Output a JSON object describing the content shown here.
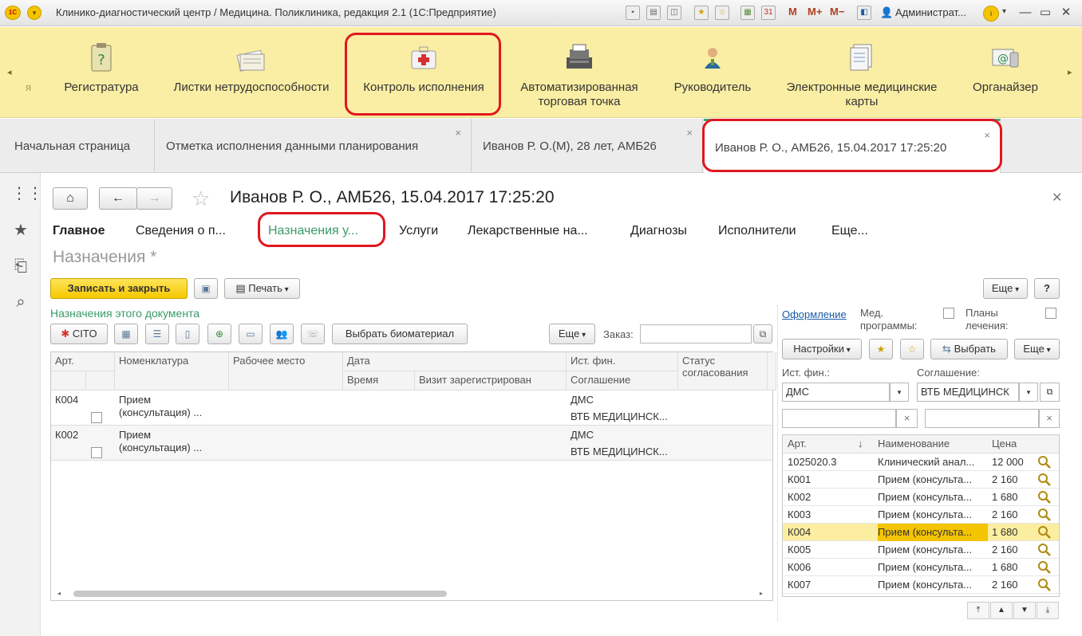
{
  "app": {
    "title": "Клинико-диагностический центр / Медицина. Поликлиника, редакция 2.1  (1С:Предприятие)",
    "logo_text": "1С",
    "user": "Администрат...",
    "memory_buttons": [
      "M",
      "M+",
      "M−"
    ]
  },
  "sections": {
    "left_partial": "я",
    "items": [
      {
        "label": "Регистратура",
        "icon": "clipboard-question-icon"
      },
      {
        "label": "Листки нетрудоспособности",
        "icon": "papers-icon"
      },
      {
        "label": "Контроль исполнения",
        "icon": "first-aid-kit-icon"
      },
      {
        "label": "Автоматизированная торговая точка",
        "icon": "cash-register-icon"
      },
      {
        "label": "Руководитель",
        "icon": "manager-icon"
      },
      {
        "label": "Электронные медицинские карты",
        "icon": "documents-icon"
      },
      {
        "label": "Органайзер",
        "icon": "email-icon"
      }
    ]
  },
  "tabs": [
    {
      "label": "Начальная страница",
      "closable": false
    },
    {
      "label": "Отметка исполнения данными планирования",
      "closable": true
    },
    {
      "label": "Иванов Р. О.(М), 28 лет, АМБ26",
      "closable": true
    },
    {
      "label": "Иванов Р. О., АМБ26, 15.04.2017 17:25:20",
      "closable": true,
      "active": true
    }
  ],
  "form": {
    "title": "Иванов Р. О., АМБ26, 15.04.2017 17:25:20",
    "nav": [
      "Главное",
      "Сведения о п...",
      "Назначения у...",
      "Услуги",
      "Лекарственные на...",
      "Диагнозы",
      "Исполнители",
      "Еще..."
    ],
    "subtitle": "Назначения *",
    "save_close": "Записать и закрыть",
    "print": "Печать",
    "more": "Еще",
    "help": "?",
    "section_label": "Назначения этого документа",
    "cito": "CITO",
    "biomaterial": "Выбрать биоматериал",
    "order_label": "Заказ:",
    "order_value": ""
  },
  "table": {
    "headers": {
      "art": "Арт.",
      "nomenclature": "Номенклатура",
      "workplace": "Рабочее место",
      "date": "Дата",
      "time": "Время",
      "visit": "Визит зарегистрирован",
      "fin_source": "Ист. фин.",
      "agreement": "Соглашение",
      "status": "Статус согласования"
    },
    "rows": [
      {
        "art": "К004",
        "name1": "Прием",
        "name2": "(консультация) ...",
        "fin": "ДМС",
        "agreement": "ВТБ МЕДИЦИНСК...",
        "checked": false
      },
      {
        "art": "К002",
        "name1": "Прием",
        "name2": "(консультация) ...",
        "fin": "ДМС",
        "agreement": "ВТБ МЕДИЦИНСК...",
        "checked": false
      }
    ]
  },
  "right": {
    "design_link": "Оформление",
    "med_programs": "Мед. программы:",
    "treatment_plans": "Планы лечения:",
    "settings": "Настройки",
    "select": "Выбрать",
    "more": "Еще",
    "fin_label": "Ист. фин.:",
    "fin_value": "ДМС",
    "agreement_label": "Соглашение:",
    "agreement_value": "ВТБ МЕДИЦИНСК",
    "headers": {
      "art": "Арт.",
      "name": "Наименование",
      "price": "Цена"
    },
    "rows": [
      {
        "art": "1025020.3",
        "name": "Клинический анал...",
        "price": "12 000"
      },
      {
        "art": "К001",
        "name": "Прием (консульта...",
        "price": "2 160"
      },
      {
        "art": "К002",
        "name": "Прием (консульта...",
        "price": "1 680"
      },
      {
        "art": "К003",
        "name": "Прием (консульта...",
        "price": "2 160"
      },
      {
        "art": "К004",
        "name": "Прием (консульта...",
        "price": "1 680",
        "selected": true
      },
      {
        "art": "К005",
        "name": "Прием (консульта...",
        "price": "2 160"
      },
      {
        "art": "К006",
        "name": "Прием (консульта...",
        "price": "1 680"
      },
      {
        "art": "К007",
        "name": "Прием (консульта...",
        "price": "2 160"
      }
    ]
  },
  "colors": {
    "accent_yellow": "#faeea4",
    "highlight": "#e0171f",
    "green": "#3a9a68"
  }
}
